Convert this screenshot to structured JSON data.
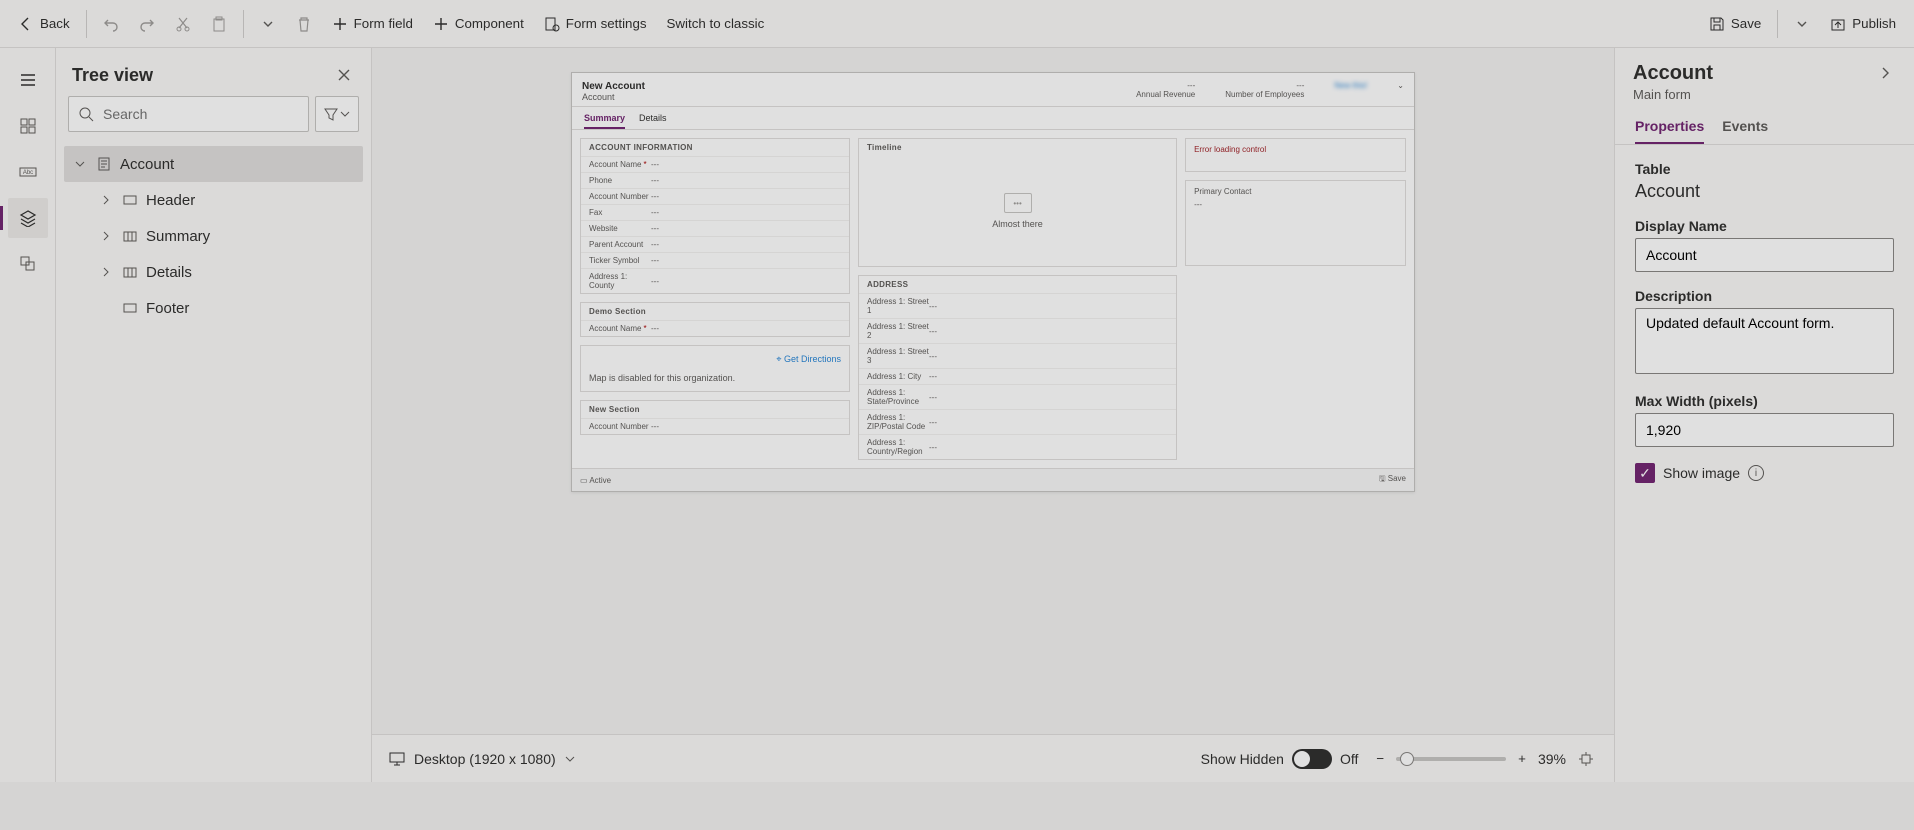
{
  "toolbar": {
    "back": "Back",
    "form_field": "Form field",
    "component": "Component",
    "form_settings": "Form settings",
    "switch_classic": "Switch to classic",
    "save": "Save",
    "publish": "Publish"
  },
  "tree": {
    "title": "Tree view",
    "search_placeholder": "Search",
    "nodes": {
      "account": "Account",
      "header": "Header",
      "summary": "Summary",
      "details": "Details",
      "footer": "Footer"
    }
  },
  "preview": {
    "title": "New Account",
    "subtitle": "Account",
    "hdr_annual": "Annual Revenue",
    "hdr_employees": "Number of Employees",
    "hdr_new": "New this!",
    "tabs": {
      "summary": "Summary",
      "details": "Details"
    },
    "s_acct_info": "ACCOUNT INFORMATION",
    "f_account_name": "Account Name",
    "f_phone": "Phone",
    "f_account_number": "Account Number",
    "f_fax": "Fax",
    "f_website": "Website",
    "f_parent": "Parent Account",
    "f_ticker": "Ticker Symbol",
    "f_addr1_county": "Address 1: County",
    "s_demo": "Demo Section",
    "map_get_dir": "Get Directions",
    "map_disabled": "Map is disabled for this organization.",
    "s_new": "New Section",
    "s_timeline": "Timeline",
    "timeline_msg": "Almost there",
    "s_address": "ADDRESS",
    "f_street1": "Address 1: Street 1",
    "f_street2": "Address 1: Street 2",
    "f_street3": "Address 1: Street 3",
    "f_city": "Address 1: City",
    "f_state": "Address 1: State/Province",
    "f_zip": "Address 1: ZIP/Postal Code",
    "f_country": "Address 1: Country/Region",
    "err_loading": "Error loading control",
    "primary_contact": "Primary Contact",
    "footer_active": "Active",
    "footer_save": "Save",
    "dash": "---"
  },
  "status": {
    "device": "Desktop (1920 x 1080)",
    "show_hidden": "Show Hidden",
    "hidden_state": "Off",
    "zoom": "39%"
  },
  "props": {
    "title": "Account",
    "subtitle": "Main form",
    "tabs": {
      "properties": "Properties",
      "events": "Events"
    },
    "table_label": "Table",
    "table_value": "Account",
    "display_name_label": "Display Name",
    "display_name_value": "Account",
    "description_label": "Description",
    "description_value": "Updated default Account form.",
    "max_width_label": "Max Width (pixels)",
    "max_width_value": "1,920",
    "show_image": "Show image"
  }
}
